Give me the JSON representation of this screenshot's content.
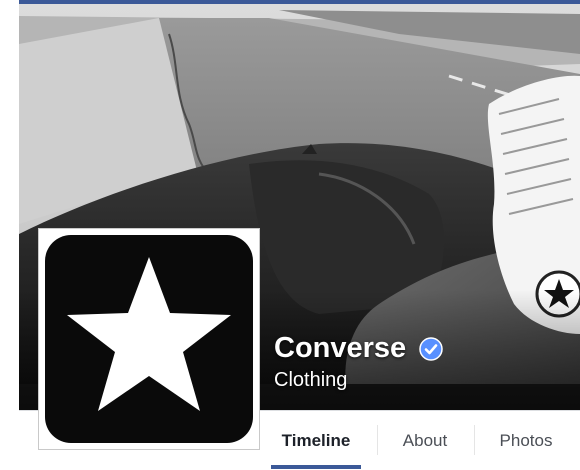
{
  "page": {
    "name": "Converse",
    "category": "Clothing",
    "verified": true,
    "verified_icon": "verified-badge-icon",
    "profile_icon": "converse-star-logo-icon",
    "cover_photo": "black-and-white desert road with sneaker on car hood"
  },
  "tabs": [
    {
      "label": "Timeline",
      "active": true
    },
    {
      "label": "About",
      "active": false
    },
    {
      "label": "Photos",
      "active": false
    }
  ],
  "colors": {
    "accent": "#3b5998",
    "verified": "#5890ff",
    "logo_bg": "#0a0a0a"
  }
}
